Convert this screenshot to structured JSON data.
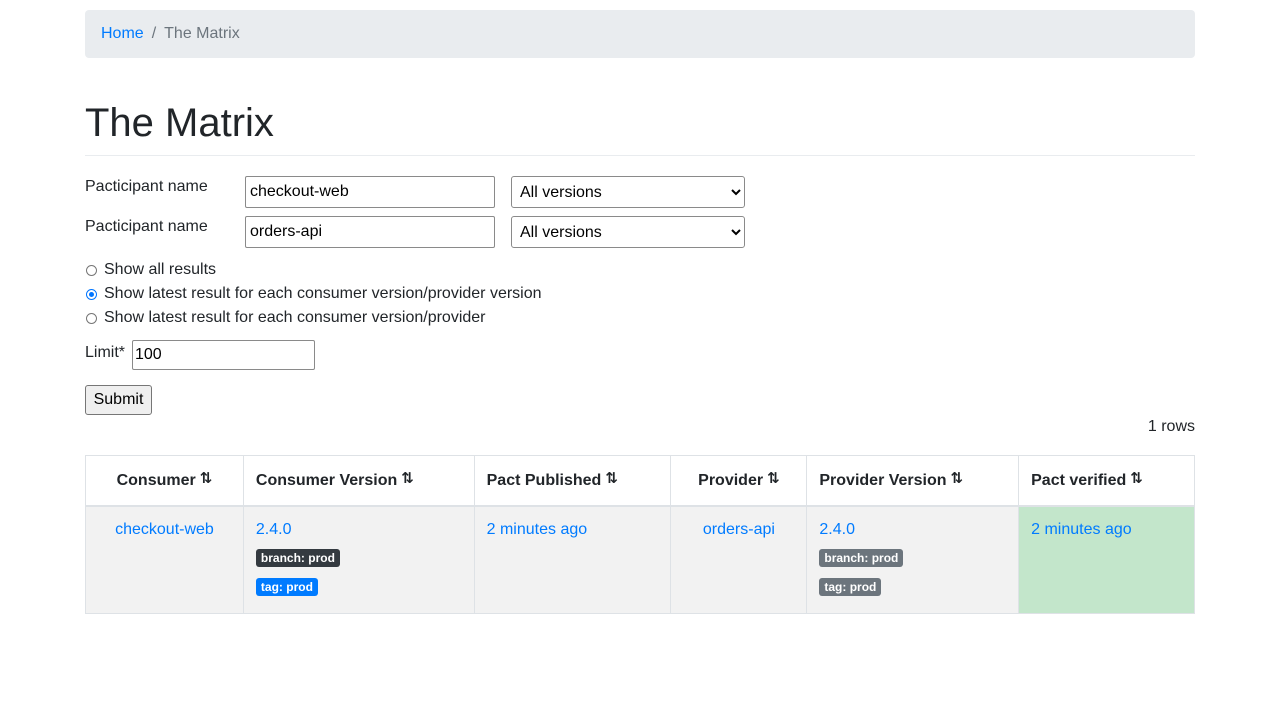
{
  "breadcrumb": {
    "home": "Home",
    "separator": "/",
    "current": "The Matrix"
  },
  "page_title": "The Matrix",
  "form": {
    "participants": [
      {
        "label": "Pacticipant name",
        "name_value": "checkout-web",
        "version_selected": "All versions"
      },
      {
        "label": "Pacticipant name",
        "name_value": "orders-api",
        "version_selected": "All versions"
      }
    ],
    "radio_options": [
      {
        "label": "Show all results",
        "checked": false
      },
      {
        "label": "Show latest result for each consumer version/provider version",
        "checked": true
      },
      {
        "label": "Show latest result for each consumer version/provider",
        "checked": false
      }
    ],
    "limit_label": "Limit*",
    "limit_value": "100",
    "submit_label": "Submit"
  },
  "row_count": "1 rows",
  "table": {
    "columns": [
      "Consumer",
      "Consumer Version",
      "Pact Published",
      "Provider",
      "Provider Version",
      "Pact verified"
    ],
    "sort_icon": "⇅",
    "rows": [
      {
        "consumer": "checkout-web",
        "consumer_version": "2.4.0",
        "consumer_branch_badge": "branch: prod",
        "consumer_tag_badge": "tag: prod",
        "pact_published": "2 minutes ago",
        "provider": "orders-api",
        "provider_version": "2.4.0",
        "provider_branch_badge": "branch: prod",
        "provider_tag_badge": "tag: prod",
        "pact_verified": "2 minutes ago",
        "verified_status": "success"
      }
    ]
  },
  "colors": {
    "link": "#007bff",
    "verified_success_bg": "#c3e6cb",
    "badge_dark": "#343a40",
    "badge_primary": "#007bff",
    "badge_secondary": "#6c757d"
  }
}
